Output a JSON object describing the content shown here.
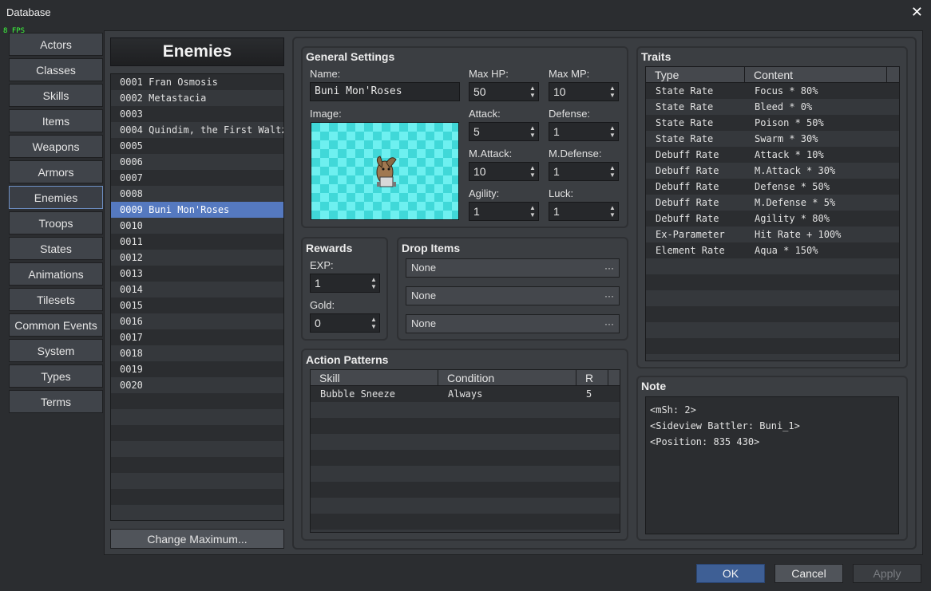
{
  "window": {
    "title": "Database",
    "fps": "8 FPS"
  },
  "categories": [
    "Actors",
    "Classes",
    "Skills",
    "Items",
    "Weapons",
    "Armors",
    "Enemies",
    "Troops",
    "States",
    "Animations",
    "Tilesets",
    "Common Events",
    "System",
    "Types",
    "Terms"
  ],
  "active_category": "Enemies",
  "enemies_panel": {
    "header": "Enemies",
    "items": [
      "0001 Fran Osmosis",
      "0002 Metastacia",
      "0003",
      "0004 Quindim, the First Waltz",
      "0005",
      "0006",
      "0007",
      "0008",
      "0009 Buni Mon'Roses",
      "0010",
      "0011",
      "0012",
      "0013",
      "0014",
      "0015",
      "0016",
      "0017",
      "0018",
      "0019",
      "0020"
    ],
    "selected": "0009 Buni Mon'Roses",
    "change_max_label": "Change Maximum..."
  },
  "general": {
    "title": "General Settings",
    "name_label": "Name:",
    "name_value": "Buni Mon'Roses",
    "image_label": "Image:",
    "maxhp_label": "Max HP:",
    "maxhp": "50",
    "maxmp_label": "Max MP:",
    "maxmp": "10",
    "attack_label": "Attack:",
    "attack": "5",
    "defense_label": "Defense:",
    "defense": "1",
    "mattack_label": "M.Attack:",
    "mattack": "10",
    "mdefense_label": "M.Defense:",
    "mdefense": "1",
    "agility_label": "Agility:",
    "agility": "1",
    "luck_label": "Luck:",
    "luck": "1"
  },
  "rewards": {
    "title": "Rewards",
    "exp_label": "EXP:",
    "exp": "1",
    "gold_label": "Gold:",
    "gold": "0"
  },
  "drops": {
    "title": "Drop Items",
    "items": [
      "None",
      "None",
      "None"
    ],
    "more": "···"
  },
  "actions": {
    "title": "Action Patterns",
    "columns": [
      "Skill",
      "Condition",
      "R"
    ],
    "rows": [
      [
        "Bubble Sneeze",
        "Always",
        "5"
      ]
    ]
  },
  "traits": {
    "title": "Traits",
    "columns": [
      "Type",
      "Content"
    ],
    "rows": [
      [
        "State Rate",
        "Focus * 80%"
      ],
      [
        "State Rate",
        "Bleed * 0%"
      ],
      [
        "State Rate",
        "Poison * 50%"
      ],
      [
        "State Rate",
        "Swarm * 30%"
      ],
      [
        "Debuff Rate",
        "Attack * 10%"
      ],
      [
        "Debuff Rate",
        "M.Attack * 30%"
      ],
      [
        "Debuff Rate",
        "Defense * 50%"
      ],
      [
        "Debuff Rate",
        "M.Defense * 5%"
      ],
      [
        "Debuff Rate",
        "Agility * 80%"
      ],
      [
        "Ex-Parameter",
        "Hit Rate + 100%"
      ],
      [
        "Element Rate",
        "Aqua * 150%"
      ]
    ]
  },
  "note": {
    "title": "Note",
    "lines": [
      "<mSh: 2>",
      "<Sideview Battler: Buni_1>",
      "<Position: 835 430>"
    ]
  },
  "footer": {
    "ok": "OK",
    "cancel": "Cancel",
    "apply": "Apply"
  }
}
